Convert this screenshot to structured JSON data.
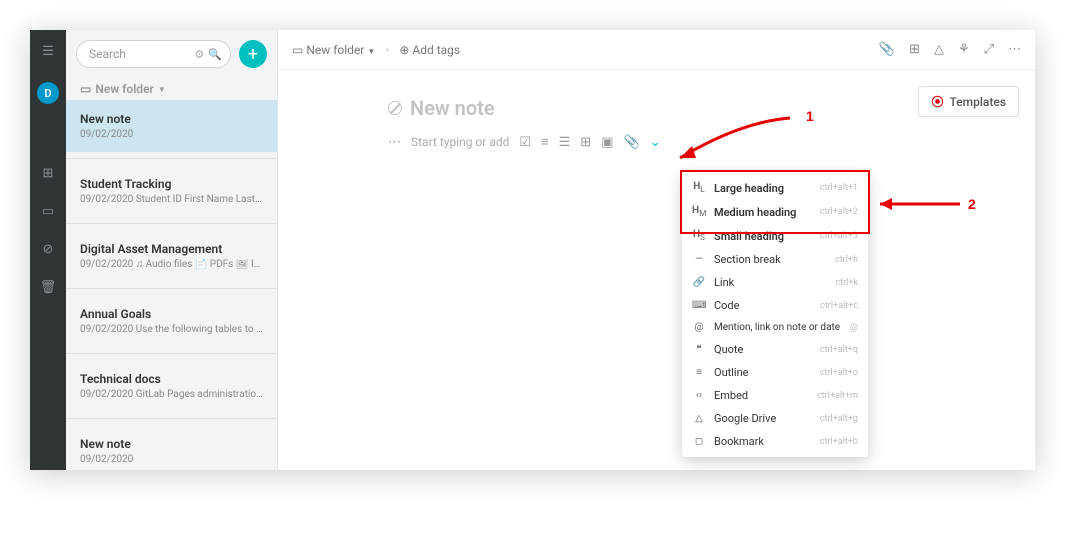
{
  "rail": {
    "avatar_letter": "D"
  },
  "sidebar": {
    "search_placeholder": "Search",
    "folder_label": "New folder",
    "notes": [
      {
        "title": "New note",
        "date": "09/02/2020",
        "preview": ""
      },
      {
        "title": "Student Tracking",
        "date": "09/02/2020",
        "preview": "Student ID First Name Last Name F..."
      },
      {
        "title": "Digital Asset Management",
        "date": "09/02/2020",
        "preview": "♫ Audio files 📄 PDFs 🖼 Images..."
      },
      {
        "title": "Annual Goals",
        "date": "09/02/2020",
        "preview": "Use the following tables to define ..."
      },
      {
        "title": "Technical docs",
        "date": "09/02/2020",
        "preview": "GitLab Pages administration Notes:..."
      },
      {
        "title": "New note",
        "date": "09/02/2020",
        "preview": ""
      }
    ]
  },
  "topbar": {
    "folder_label": "New folder",
    "addtags_label": "Add tags"
  },
  "editor": {
    "title_placeholder": "New note",
    "body_placeholder": "Start typing or add",
    "templates_label": "Templates"
  },
  "dropdown": {
    "items": [
      {
        "icon": "H",
        "sub": "L",
        "label": "Large heading",
        "shortcut": "ctrl+alt+1",
        "bold": true
      },
      {
        "icon": "H",
        "sub": "M",
        "label": "Medium heading",
        "shortcut": "ctrl+alt+2",
        "bold": true
      },
      {
        "icon": "H",
        "sub": "S",
        "label": "Small heading",
        "shortcut": "ctrl+alt+3",
        "bold": true
      },
      {
        "icon": "—",
        "sub": "",
        "label": "Section break",
        "shortcut": "ctrl+h",
        "bold": false
      },
      {
        "icon": "🔗",
        "sub": "",
        "label": "Link",
        "shortcut": "ctrl+k",
        "bold": false
      },
      {
        "icon": "⌨",
        "sub": "",
        "label": "Code",
        "shortcut": "ctrl+alt+c",
        "bold": false
      },
      {
        "icon": "@",
        "sub": "",
        "label": "Mention, link on note or date",
        "shortcut": "@",
        "bold": false
      },
      {
        "icon": "❝",
        "sub": "",
        "label": "Quote",
        "shortcut": "ctrl+alt+q",
        "bold": false
      },
      {
        "icon": "≡",
        "sub": "",
        "label": "Outline",
        "shortcut": "ctrl+alt+o",
        "bold": false
      },
      {
        "icon": "‹›",
        "sub": "",
        "label": "Embed",
        "shortcut": "ctrl+alt+m",
        "bold": false
      },
      {
        "icon": "△",
        "sub": "",
        "label": "Google Drive",
        "shortcut": "ctrl+alt+g",
        "bold": false
      },
      {
        "icon": "◻",
        "sub": "",
        "label": "Bookmark",
        "shortcut": "ctrl+alt+b",
        "bold": false
      }
    ]
  },
  "callouts": {
    "one": "1",
    "two": "2"
  }
}
